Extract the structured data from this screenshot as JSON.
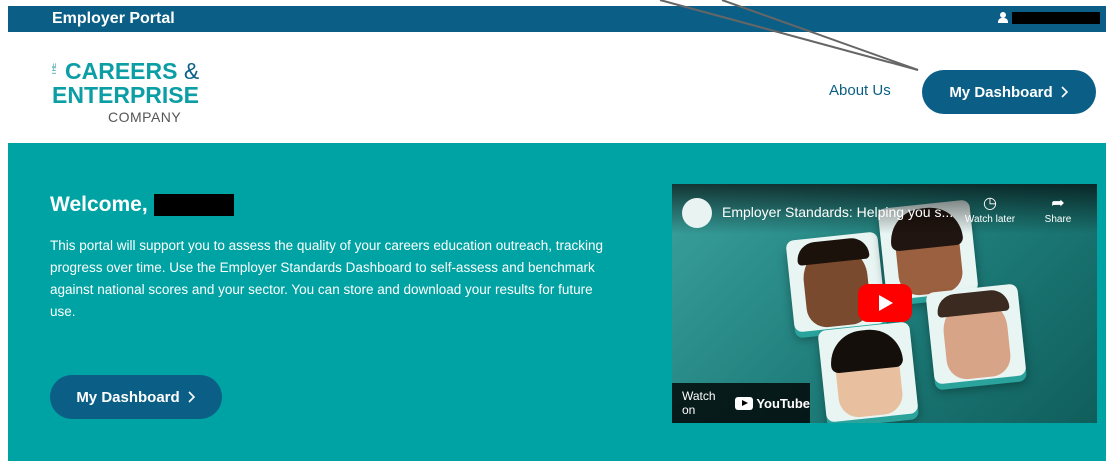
{
  "topbar": {
    "brand": "Employer Portal"
  },
  "logo": {
    "the": "THE",
    "line1": "CAREERS",
    "amp": "&",
    "line2": "ENTERPRISE",
    "line3": "COMPANY"
  },
  "nav": {
    "about": "About Us",
    "dashboard": "My Dashboard"
  },
  "hero": {
    "welcome": "Welcome,",
    "intro": "This portal will support you to assess the quality of your careers education outreach, tracking progress over time. Use the Employer Standards Dashboard to self-assess and benchmark against national scores and your sector. You can store and download your results for future use.",
    "cta": "My Dashboard"
  },
  "video": {
    "title": "Employer Standards: Helping you s...",
    "watch_later": "Watch later",
    "share": "Share",
    "watch_on": "Watch on",
    "youtube": "YouTube"
  },
  "colors": {
    "primary": "#0b5f86",
    "teal": "#00a3a3",
    "logo_teal": "#0b9ea4"
  }
}
